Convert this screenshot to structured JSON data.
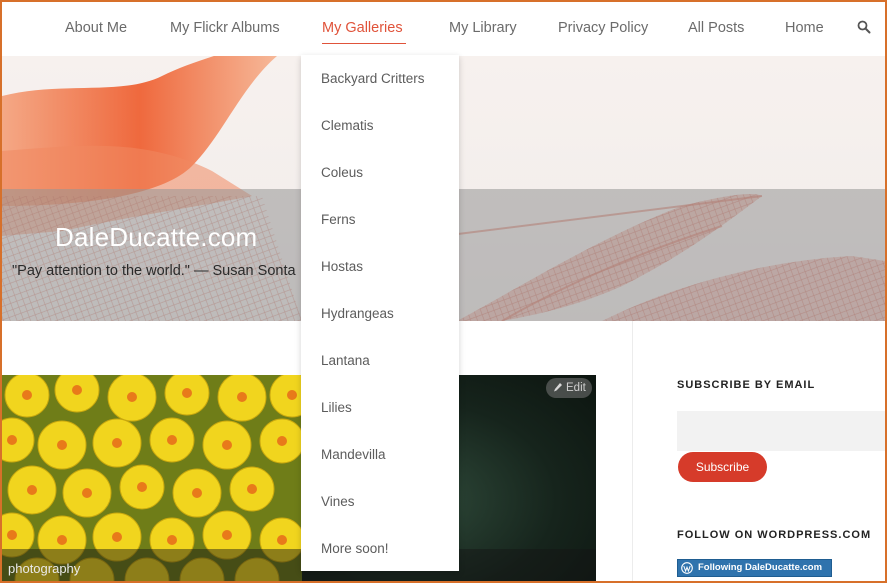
{
  "nav": {
    "items": [
      {
        "label": "About Me"
      },
      {
        "label": "My Flickr Albums"
      },
      {
        "label": "My Galleries"
      },
      {
        "label": "My Library"
      },
      {
        "label": "Privacy Policy"
      },
      {
        "label": "All Posts"
      },
      {
        "label": "Home"
      }
    ],
    "active_index": 2,
    "active_color": "#e0533a",
    "search_icon": "search-icon"
  },
  "dropdown": {
    "items": [
      {
        "label": "Backyard Critters"
      },
      {
        "label": "Clematis"
      },
      {
        "label": "Coleus"
      },
      {
        "label": "Ferns"
      },
      {
        "label": "Hostas"
      },
      {
        "label": "Hydrangeas"
      },
      {
        "label": "Lantana"
      },
      {
        "label": "Lilies"
      },
      {
        "label": "Mandevilla"
      },
      {
        "label": "Vines"
      },
      {
        "label": "More soon!"
      }
    ]
  },
  "site": {
    "title": "DaleDucatte.com",
    "tagline": "\"Pay attention to the world.\" — Susan Sonta"
  },
  "post": {
    "category": "photography",
    "edit_label": "Edit",
    "edit_icon": "pencil-icon"
  },
  "sidebar": {
    "subscribe": {
      "title": "SUBSCRIBE BY EMAIL",
      "email_value": "",
      "button_label": "Subscribe",
      "button_color": "#d63b2a"
    },
    "follow": {
      "title": "FOLLOW ON WORDPRESS.COM",
      "button_label": "Following DaleDucatte.com",
      "button_icon": "wordpress-icon",
      "button_color": "#2f73ad"
    }
  },
  "colors": {
    "frame": "#d7702a",
    "accent": "#e0533a"
  }
}
